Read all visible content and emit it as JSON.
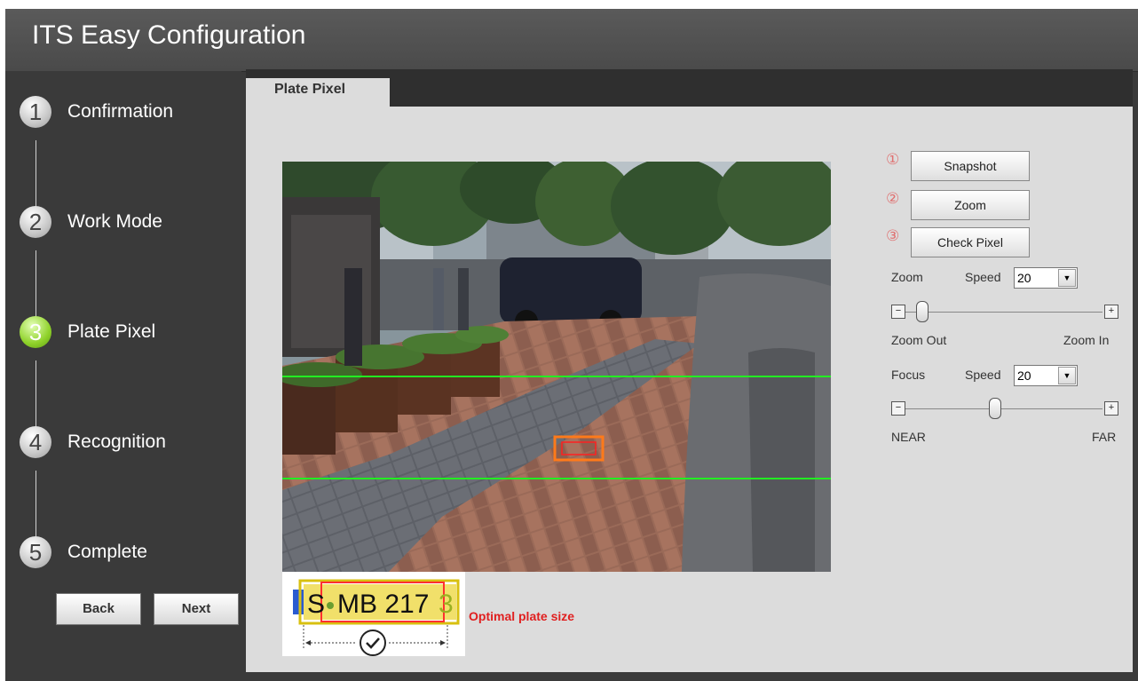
{
  "window": {
    "title": "ITS Easy Configuration"
  },
  "sidebar": {
    "steps": [
      {
        "num": "1",
        "label": "Confirmation",
        "active": false
      },
      {
        "num": "2",
        "label": "Work Mode",
        "active": false
      },
      {
        "num": "3",
        "label": "Plate Pixel",
        "active": true
      },
      {
        "num": "4",
        "label": "Recognition",
        "active": false
      },
      {
        "num": "5",
        "label": "Complete",
        "active": false
      }
    ],
    "back_label": "Back",
    "next_label": "Next"
  },
  "tabs": [
    {
      "label": "Plate Pixel",
      "active": true
    }
  ],
  "preview": {
    "plate_text": "MB 217",
    "plate_prefix": "S",
    "plate_suffix": "3",
    "optimal_label": "Optimal plate size"
  },
  "panel": {
    "steps": [
      {
        "marker": "①",
        "label": "Snapshot"
      },
      {
        "marker": "②",
        "label": "Zoom"
      },
      {
        "marker": "③",
        "label": "Check Pixel"
      }
    ],
    "zoom": {
      "label": "Zoom",
      "speed_label": "Speed",
      "speed_value": "20",
      "min_label": "Zoom Out",
      "max_label": "Zoom In",
      "minus": "−",
      "plus": "+",
      "level": 0.08
    },
    "focus": {
      "label": "Focus",
      "speed_label": "Speed",
      "speed_value": "20",
      "min_label": "NEAR",
      "max_label": "FAR",
      "minus": "−",
      "plus": "+",
      "level": 0.45
    }
  },
  "colors": {
    "active_step": "#8fd22a",
    "marker": "#e07070",
    "optimal_text": "#e02020",
    "guide_line": "#22ee22",
    "plate_box": "#ff2020"
  }
}
